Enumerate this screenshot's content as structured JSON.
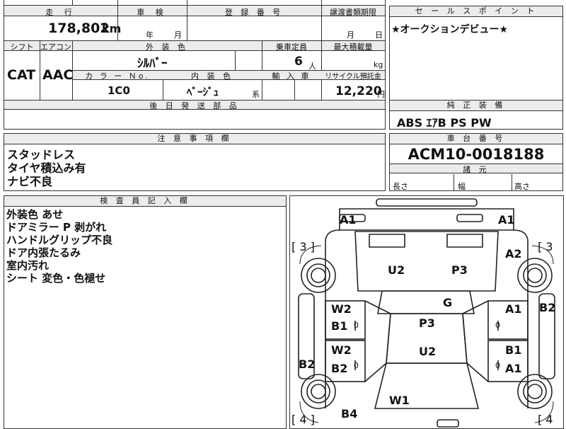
{
  "top": {
    "mileage_header": "走 行",
    "mileage_value": "178,802",
    "mileage_unit": "km",
    "shaken_header": "車 検",
    "shaken_year": "年",
    "shaken_month": "月",
    "reg_header": "登 録 番 号",
    "transfer_header": "譲渡書類期限",
    "transfer_month": "月",
    "transfer_day": "日",
    "shift_header": "シフト",
    "ac_header": "エアコン",
    "shift_value": "CAT",
    "ac_value": "AAC",
    "exterior_color_header": "外 装 色",
    "exterior_color_value": "ｼﾙﾊﾞｰ",
    "capacity_header": "乗車定員",
    "capacity_value": "6",
    "capacity_unit": "人",
    "max_load_header": "最大積載量",
    "max_load_unit": "kg",
    "color_no_header": "カ ラ ー Ｎo.",
    "color_no_value": "1C0",
    "interior_color_header": "内 装 色",
    "interior_color_value": "ﾍﾞｰｼﾞｭ",
    "interior_color_suffix": "系",
    "import_header": "輸 入 車",
    "recycle_header": "リサイクル預託金",
    "recycle_value": "12,220",
    "recycle_unit": "円",
    "delivery_header": "後 日 発 送 部 品"
  },
  "sales_point": {
    "header": "セ ー ル ス ポ イ ン ト",
    "text": "★オークションデビュー★"
  },
  "equipment": {
    "header": "純 正 装 備",
    "text": "ABS ｴｱB PS PW"
  },
  "caution": {
    "header": "注 意 事 項 欄",
    "lines": [
      "スタッドレス",
      "タイヤ積込み有",
      "ナビ不良"
    ]
  },
  "chassis": {
    "header": "車 台 番 号",
    "value": "ACM10-0018188",
    "dims_header": "諸 元",
    "length_label": "長さ",
    "width_label": "幅",
    "height_label": "高さ"
  },
  "inspector": {
    "header": "検 査 員 記 入 欄",
    "lines": [
      "外装色 あせ",
      "ドアミラー P 剥がれ",
      "ハンドルグリップ不良",
      "ドア内張たるみ",
      "室内汚れ",
      "シート 変色・色褪せ"
    ]
  },
  "diagram": {
    "marks": {
      "a1_front_left": "A1",
      "a1_front_right": "A1",
      "three_left": "[ 3 ]",
      "three_right": "[ 3",
      "a2_right": "A2",
      "u2_hood": "U2",
      "p3_hood": "P3",
      "g_windshield": "G",
      "w2_left_front_door": "W2",
      "b1_left_front_door": "B1",
      "p3_roof": "P3",
      "a1_right_front_door": "A1",
      "b2_right_side": "B2",
      "w2_left_rear_door": "W2",
      "b2_left_rear_door": "B2",
      "u2_roof_rear": "U2",
      "b1_right_rear_door": "B1",
      "a1_right_rear_door": "A1",
      "b2_left_side": "B2",
      "w1_rear_glass": "W1",
      "b4_rear": "B4",
      "four_left": "[ 4 ]",
      "four_right": "[ 4",
      "zero_1": "0",
      "zero_2": "0",
      "zero_3": "0",
      "zero_4": "0"
    }
  }
}
